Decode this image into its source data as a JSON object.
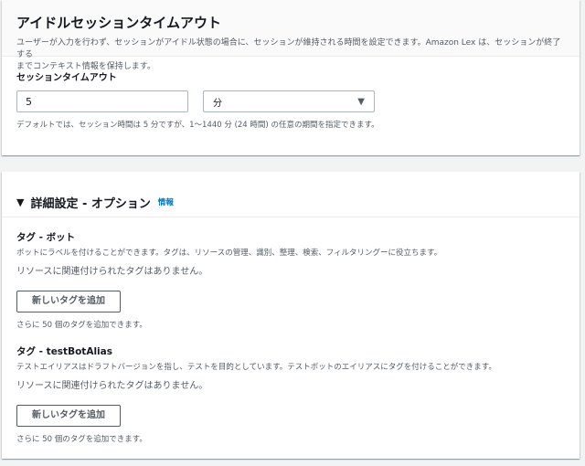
{
  "session": {
    "title": "アイドルセッションタイムアウト",
    "description_line1": "ユーザーが入力を行わず、セッションがアイドル状態の場合に、セッションが維持される時間を設定できます。Amazon Lex は、セッションが終了する",
    "description_line2": "までコンテキスト情報を保持します。",
    "field_label": "セッションタイムアウト",
    "timeout_value": "5",
    "unit_selected": "分",
    "hint": "デフォルトでは、セッション時間は 5 分ですが、1～1440 分 (24 時間) の任意の期間を指定できます。"
  },
  "advanced": {
    "title": "詳細設定 - オプション",
    "info_label": "情報",
    "expanded": true,
    "bot_tags": {
      "title": "タグ - ボット",
      "description": "ボットにラベルを付けることができます。タグは、リソースの管理、識別、整理、検索、フィルタリングーに役立ちます。",
      "empty_text": "リソースに関連付けられたタグはありません。",
      "add_button": "新しいタグを追加",
      "footer": "さらに 50 個のタグを追加できます。"
    },
    "alias_tags": {
      "title": "タグ - testBotAlias",
      "description": "テストエイリアスはドラフトバージョンを指し、テストを目的としています。テストボットのエイリアスにタグを付けることができます。",
      "empty_text": "リソースに関連付けられたタグはありません。",
      "add_button": "新しいタグを追加",
      "footer": "さらに 50 個のタグを追加できます。"
    }
  },
  "icons": {
    "select_caret": "▼",
    "expander": "▼"
  },
  "colors": {
    "link": "#0073bb",
    "background": "#f2f3f3",
    "text": "#16191f",
    "secondary_text": "#545b64"
  }
}
